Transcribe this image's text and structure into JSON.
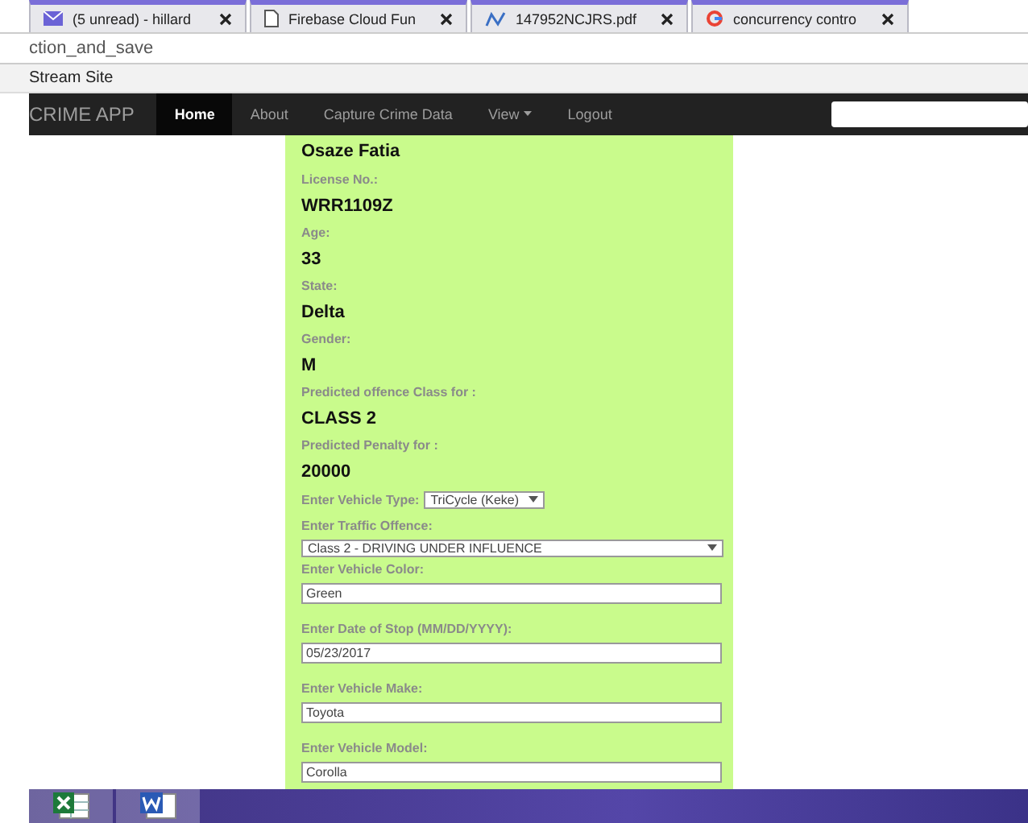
{
  "browser_tabs": [
    {
      "label": "(5 unread) - hillard",
      "selected": false
    },
    {
      "label": "Firebase Cloud Fun",
      "selected": false
    },
    {
      "label": "147952NCJRS.pdf",
      "selected": false
    },
    {
      "label": "concurrency contro",
      "selected": false
    }
  ],
  "address_bar": {
    "value": "ction_and_save"
  },
  "bookmarks": [
    "Stream Site"
  ],
  "navbar": {
    "brand": "CRIME APP",
    "items": [
      {
        "label": "Home",
        "selected": true,
        "dropdown": false
      },
      {
        "label": "About",
        "selected": false,
        "dropdown": false
      },
      {
        "label": "Capture Crime Data",
        "selected": false,
        "dropdown": false
      },
      {
        "label": "View",
        "selected": false,
        "dropdown": true
      },
      {
        "label": "Logout",
        "selected": false,
        "dropdown": false
      }
    ]
  },
  "form": {
    "name": "Osaze Fatia",
    "details": [
      {
        "label": "License No.:",
        "value": "WRR1109Z"
      },
      {
        "label": "Age:",
        "value": "33"
      },
      {
        "label": "State:",
        "value": "Delta"
      },
      {
        "label": "Gender:",
        "value": "M"
      },
      {
        "label": "Predicted offence Class for :",
        "value": "CLASS 2"
      },
      {
        "label": "Predicted Penalty for :",
        "value": "20000"
      }
    ],
    "fields": [
      {
        "kind": "inline-select",
        "label": "Enter Vehicle Type:",
        "value": "TriCycle (Keke)"
      },
      {
        "kind": "select",
        "label": "Enter Traffic Offence:",
        "value": "Class 2 - DRIVING UNDER INFLUENCE"
      },
      {
        "kind": "text",
        "label": "Enter Vehicle Color:",
        "value": "Green"
      },
      {
        "kind": "text",
        "label": "Enter Date of Stop (MM/DD/YYYY):",
        "value": "05/23/2017"
      },
      {
        "kind": "text",
        "label": "Enter Vehicle Make:",
        "value": "Toyota"
      },
      {
        "kind": "text",
        "label": "Enter Vehicle Model:",
        "value": "Corolla"
      }
    ]
  }
}
